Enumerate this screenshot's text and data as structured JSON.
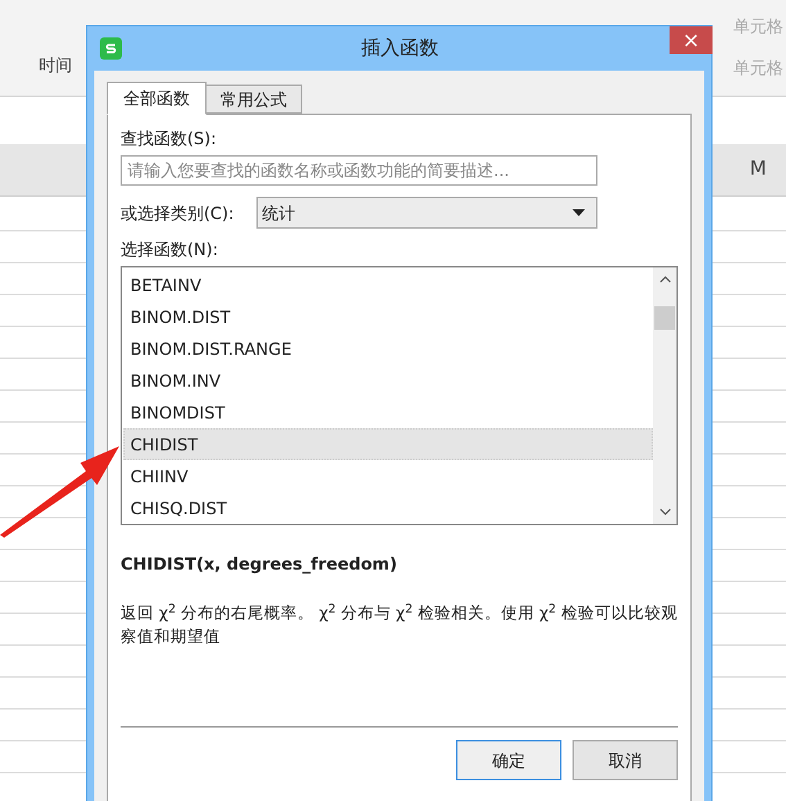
{
  "background": {
    "ribbon_labels": [
      "时间",
      "单元格",
      "单元格"
    ],
    "column_header": "M"
  },
  "window": {
    "title": "插入函数",
    "close": "×"
  },
  "tabs": [
    {
      "label": "全部函数",
      "selected": true
    },
    {
      "label": "常用公式",
      "selected": false
    }
  ],
  "search": {
    "label": "查找函数(S):",
    "placeholder": "请输入您要查找的函数名称或函数功能的简要描述..."
  },
  "category": {
    "label": "或选择类别(C):",
    "value": "统计"
  },
  "functions": {
    "label": "选择函数(N):",
    "items": [
      {
        "name": "BETAINV",
        "selected": false
      },
      {
        "name": "BINOM.DIST",
        "selected": false
      },
      {
        "name": "BINOM.DIST.RANGE",
        "selected": false
      },
      {
        "name": "BINOM.INV",
        "selected": false
      },
      {
        "name": "BINOMDIST",
        "selected": false
      },
      {
        "name": "CHIDIST",
        "selected": true
      },
      {
        "name": "CHIINV",
        "selected": false
      },
      {
        "name": "CHISQ.DIST",
        "selected": false
      }
    ]
  },
  "signature": "CHIDIST(x, degrees_freedom)",
  "description": "返回 χ$^{2}$ 分布的右尾概率。 χ$^{2}$ 分布与 χ$^{2}$ 检验相关。使用 χ$^{2}$ 检验可以比较观察值和期望值",
  "buttons": [
    {
      "label": "确定",
      "kind": "default"
    },
    {
      "label": "取消",
      "kind": "normal"
    }
  ]
}
